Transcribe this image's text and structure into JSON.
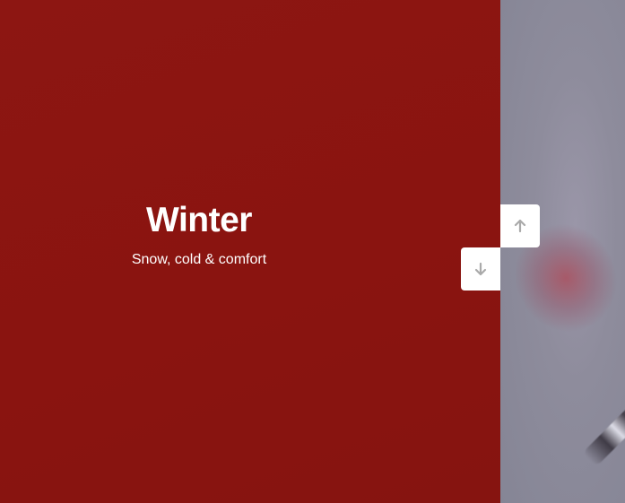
{
  "slide": {
    "title": "Winter",
    "subtitle": "Snow, cold & comfort",
    "panel_color": "#8b1511"
  },
  "controls": {
    "up_icon": "arrow-up-icon",
    "down_icon": "arrow-down-icon",
    "icon_color": "#aaaaaa"
  }
}
